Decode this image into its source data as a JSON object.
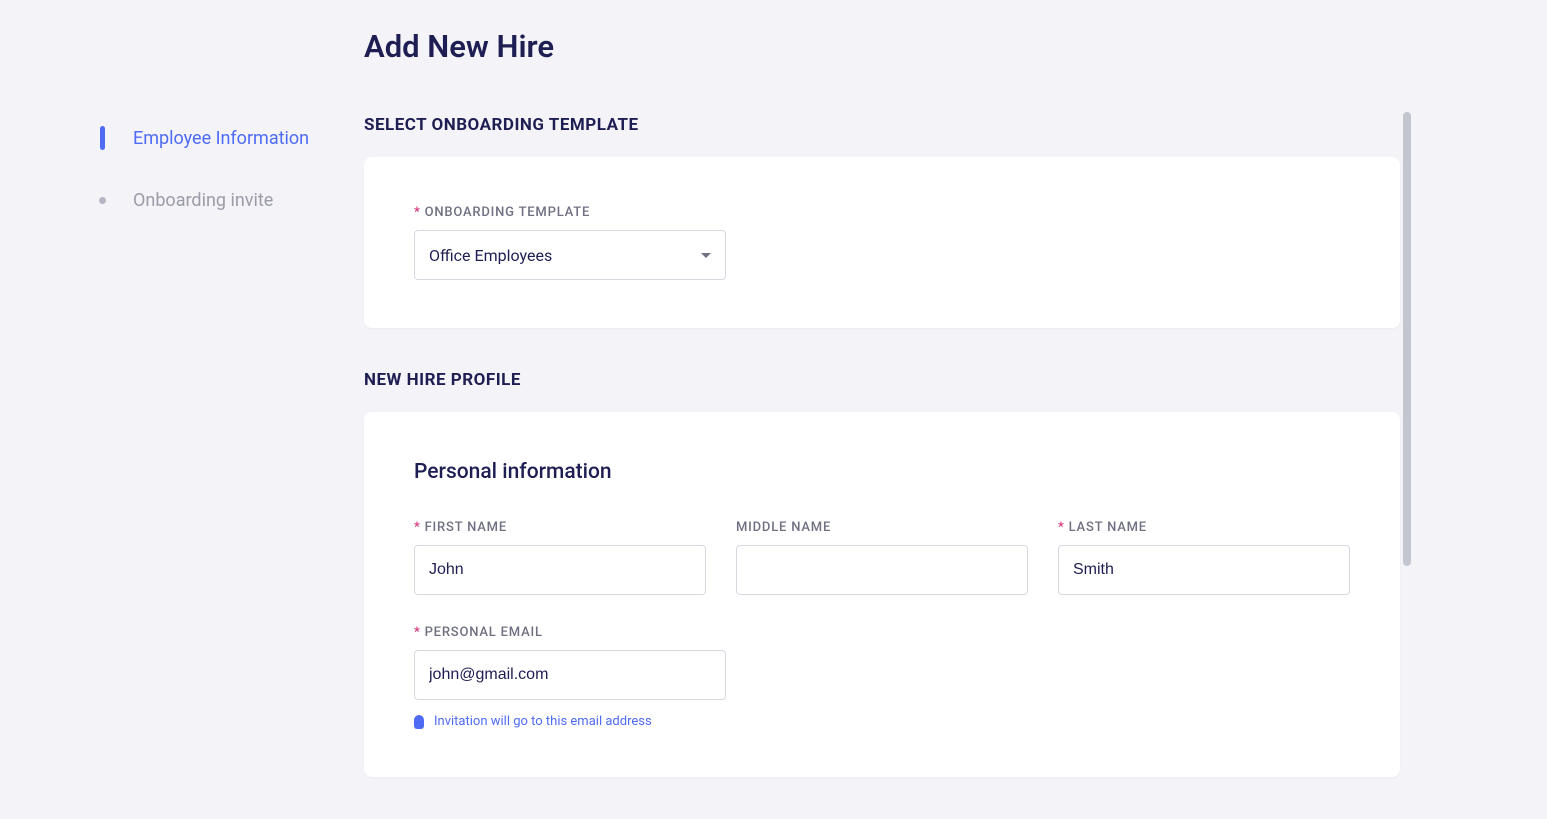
{
  "page_title": "Add New Hire",
  "sidebar": {
    "items": [
      {
        "label": "Employee Information",
        "active": true
      },
      {
        "label": "Onboarding invite",
        "active": false
      }
    ]
  },
  "sections": {
    "template": {
      "header": "SELECT ONBOARDING TEMPLATE",
      "field_label": "ONBOARDING TEMPLATE",
      "selected": "Office Employees"
    },
    "profile": {
      "header": "NEW HIRE PROFILE",
      "subsection": "Personal information",
      "first_name": {
        "label": "FIRST NAME",
        "value": "John"
      },
      "middle_name": {
        "label": "MIDDLE NAME",
        "value": ""
      },
      "last_name": {
        "label": "LAST NAME",
        "value": "Smith"
      },
      "personal_email": {
        "label": "PERSONAL EMAIL",
        "value": "john@gmail.com",
        "help": "Invitation will go to this email address"
      }
    }
  }
}
